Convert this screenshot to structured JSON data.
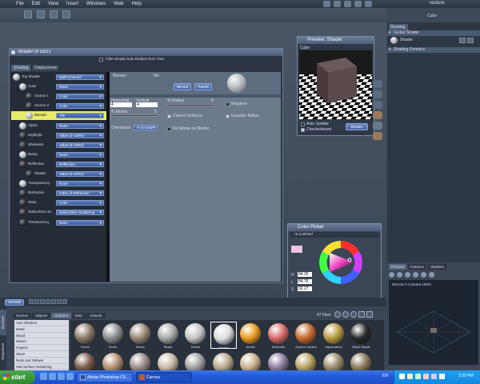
{
  "menu": {
    "items": [
      "File",
      "Edit",
      "View",
      "Insert",
      "Windows",
      "Web",
      "Help"
    ],
    "right_title": "Texture"
  },
  "cube_tab": "Cube",
  "right_panel": {
    "tab": "Shading",
    "global_shader": "Global Shader",
    "shader": "Shader",
    "domains": "Shading Domains"
  },
  "shader_window": {
    "title": "Shader of Doc1",
    "filter_label": "Filter Simple Sub-Shaders from Tree",
    "tabs": [
      "Shading",
      "Displacement"
    ],
    "tree": [
      {
        "label": "Top Shader",
        "value": "Multi-Channel",
        "ball": "light",
        "level": 0
      },
      {
        "label": "Color",
        "value": "Mixer",
        "ball": "light",
        "level": 1
      },
      {
        "label": "Source 1",
        "value": "Color",
        "ball": "dark",
        "level": 2
      },
      {
        "label": "Source 2",
        "value": "Color",
        "ball": "dark",
        "level": 2
      },
      {
        "label": "Blender",
        "value": "Tile",
        "ball": "light",
        "level": 2,
        "selected": true
      },
      {
        "label": "Alpha",
        "value": "None",
        "ball": "light",
        "level": 1
      },
      {
        "label": "Highlight",
        "value": "Value (0-100%)",
        "ball": "dark",
        "level": 1
      },
      {
        "label": "Shininess",
        "value": "Value (0-100%)",
        "ball": "dark",
        "level": 1
      },
      {
        "label": "Bump",
        "value": "None",
        "ball": "light",
        "level": 1
      },
      {
        "label": "Reflection",
        "value": "Reflection",
        "ball": "dark",
        "level": 1
      },
      {
        "label": "Shader",
        "value": "Value (0-100%)",
        "ball": "dark",
        "level": 2
      },
      {
        "label": "Transparency",
        "value": "None",
        "ball": "light",
        "level": 1
      },
      {
        "label": "Refraction",
        "value": "Index of Refraction",
        "ball": "dark",
        "level": 1
      },
      {
        "label": "Glow",
        "value": "Color",
        "ball": "dark",
        "level": 1
      },
      {
        "label": "Subsurface Sc.",
        "value": "Subsurface Scattering",
        "ball": "dark",
        "level": 1
      },
      {
        "label": "Translucency",
        "value": "None",
        "ball": "dark",
        "level": 1
      }
    ],
    "detail": {
      "header_left": "Blender",
      "header_mid": "Tile",
      "wizard": "Wizard",
      "parent": "Parent",
      "horizontal_label": "Horizontal",
      "horizontal_value": "4",
      "vertical_label": "Vertical",
      "vertical_value": "4",
      "radius_label": "% Radius",
      "radius_value": "8",
      "mortar_label": "% Mortar",
      "mortar_value": "5",
      "negative": "Negative",
      "curved": "Curved Surfaces",
      "equalize": "Equalize Ratios",
      "orientation_label": "Orientation",
      "orientation_value": "Horizontal",
      "no_mortar": "No Mortar on Border"
    }
  },
  "preview": {
    "title": "Preview: Shader",
    "object": "Cube",
    "auto_update": "Auto Update",
    "checkerboard": "Checkerboard",
    "render": "Render"
  },
  "color_picker": {
    "title": "Color Picker",
    "mode": "HLS Wheel",
    "h_label": "H",
    "h_value": "84.25",
    "l_label": "L",
    "l_value": "84.76",
    "s_label": "S",
    "s_value": "92.27"
  },
  "director": {
    "tabs": [
      "Preview",
      "Instance",
      "Shaders"
    ],
    "label": "Director's Camera 100%"
  },
  "browser": {
    "animate": "Animate",
    "tabs": [
      "Scenes",
      "Objects",
      "Shaders",
      "Misc",
      "Artwork"
    ],
    "side_tabs": [
      "Browser",
      "Sequencer"
    ],
    "file_count": "47 Files",
    "categories": [
      "Auto Shaders",
      "Metal",
      "Wood",
      "Nature",
      "Organic",
      "Stone",
      "Reds and Yellows",
      "Sub-Surface Scattering"
    ],
    "items": [
      {
        "label": "Rocks",
        "color": "#8a7a66"
      },
      {
        "label": "Stone",
        "color": "#8b8c8e"
      },
      {
        "label": "Bricks",
        "color": "#9b8877"
      },
      {
        "label": "Brass",
        "color": "#a8a8a8"
      },
      {
        "label": "Bricks",
        "color": "#c4c4c4"
      },
      {
        "label": "Border",
        "color": "#dcdcdc"
      },
      {
        "label": "Amber",
        "color": "#e89a20"
      },
      {
        "label": "Artichoke",
        "color": "#d86a6a"
      },
      {
        "label": "Apache Quartz",
        "color": "#c86a30"
      },
      {
        "label": "Aquamarine",
        "color": "#b89a40"
      },
      {
        "label": "Black Basalt",
        "color": "#2a2a2a"
      }
    ],
    "row2_colors": [
      "#7a5a4a",
      "#b09070",
      "#9a8a8a",
      "#c8b8a8",
      "#a0a0a0",
      "#b8a88a",
      "#c8b090",
      "#8a7aa0",
      "#b8a060",
      "#9a8a6a",
      "#8a7a5a"
    ]
  },
  "taskbar": {
    "start": "start",
    "tasks": [
      "Adobe Photoshop CS...",
      "Carrara"
    ],
    "lang": "EN",
    "time": "2:30 PM"
  }
}
